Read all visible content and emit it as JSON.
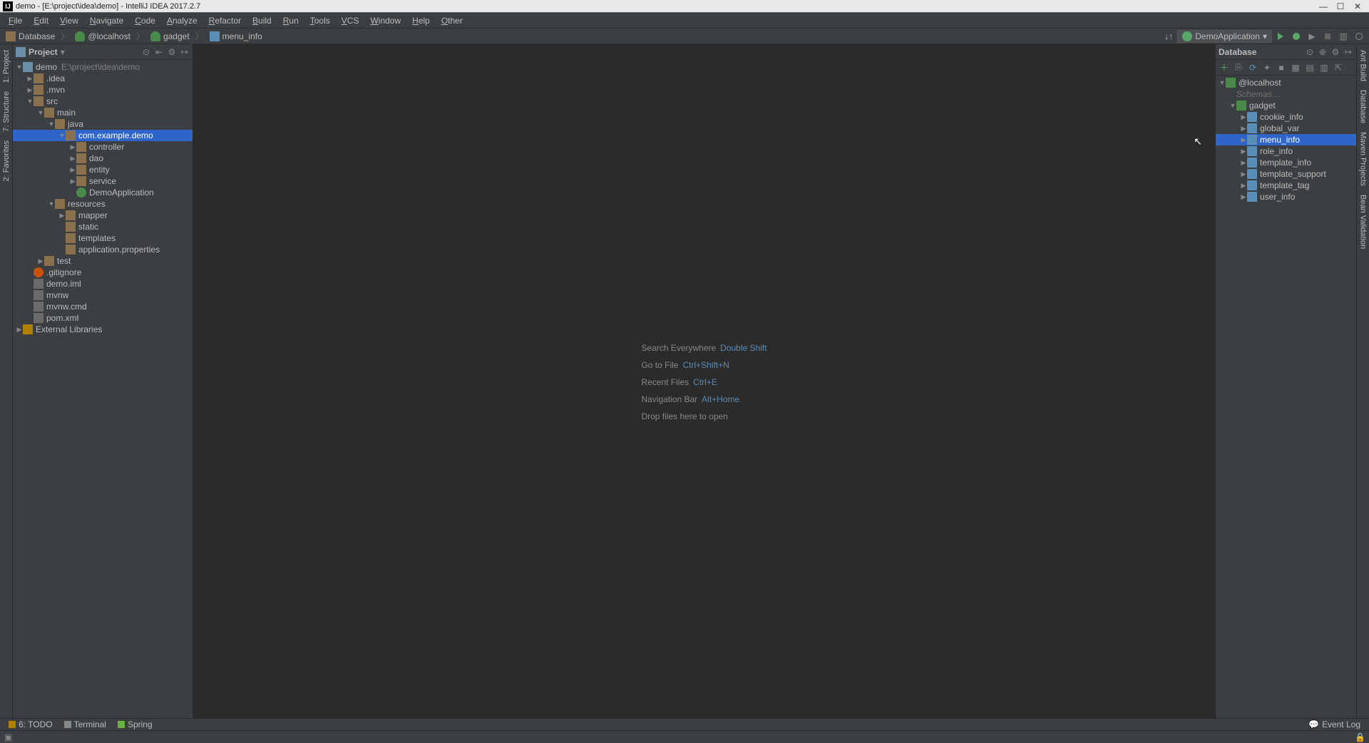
{
  "titlebar": {
    "title": "demo - [E:\\project\\idea\\demo] - IntelliJ IDEA 2017.2.7"
  },
  "menu": {
    "items": [
      "File",
      "Edit",
      "View",
      "Navigate",
      "Code",
      "Analyze",
      "Refactor",
      "Build",
      "Run",
      "Tools",
      "VCS",
      "Window",
      "Help",
      "Other"
    ]
  },
  "breadcrumbs": [
    {
      "icon": "folder",
      "label": "Database"
    },
    {
      "icon": "db",
      "label": "@localhost"
    },
    {
      "icon": "db",
      "label": "gadget"
    },
    {
      "icon": "table",
      "label": "menu_info"
    }
  ],
  "run": {
    "config": "DemoApplication"
  },
  "left_gutter": {
    "tabs": [
      "1: Project",
      "7: Structure",
      "2: Favorites"
    ]
  },
  "right_gutter": {
    "tabs": [
      "Ant Build",
      "Database",
      "Maven Projects",
      "Bean Validation"
    ]
  },
  "project_panel": {
    "title": "Project"
  },
  "project_tree": [
    {
      "d": 0,
      "exp": "open",
      "icon": "mod",
      "label": "demo",
      "extra": "E:\\project\\idea\\demo"
    },
    {
      "d": 1,
      "exp": "closed",
      "icon": "folder",
      "label": ".idea"
    },
    {
      "d": 1,
      "exp": "closed",
      "icon": "folder",
      "label": ".mvn"
    },
    {
      "d": 1,
      "exp": "open",
      "icon": "folder",
      "label": "src"
    },
    {
      "d": 2,
      "exp": "open",
      "icon": "folder",
      "label": "main"
    },
    {
      "d": 3,
      "exp": "open",
      "icon": "folder",
      "label": "java"
    },
    {
      "d": 4,
      "exp": "open",
      "icon": "pkg",
      "label": "com.example.demo",
      "sel": true
    },
    {
      "d": 5,
      "exp": "closed",
      "icon": "pkg",
      "label": "controller"
    },
    {
      "d": 5,
      "exp": "closed",
      "icon": "pkg",
      "label": "dao"
    },
    {
      "d": 5,
      "exp": "closed",
      "icon": "pkg",
      "label": "entity"
    },
    {
      "d": 5,
      "exp": "closed",
      "icon": "pkg",
      "label": "service"
    },
    {
      "d": 5,
      "exp": "none",
      "icon": "cls",
      "label": "DemoApplication"
    },
    {
      "d": 3,
      "exp": "open",
      "icon": "folder",
      "label": "resources"
    },
    {
      "d": 4,
      "exp": "closed",
      "icon": "folder",
      "label": "mapper"
    },
    {
      "d": 4,
      "exp": "none",
      "icon": "folder",
      "label": "static"
    },
    {
      "d": 4,
      "exp": "none",
      "icon": "folder",
      "label": "templates"
    },
    {
      "d": 4,
      "exp": "none",
      "icon": "prop",
      "label": "application.properties"
    },
    {
      "d": 2,
      "exp": "closed",
      "icon": "folder",
      "label": "test"
    },
    {
      "d": 1,
      "exp": "none",
      "icon": "git",
      "label": ".gitignore"
    },
    {
      "d": 1,
      "exp": "none",
      "icon": "file",
      "label": "demo.iml"
    },
    {
      "d": 1,
      "exp": "none",
      "icon": "file",
      "label": "mvnw"
    },
    {
      "d": 1,
      "exp": "none",
      "icon": "file",
      "label": "mvnw.cmd"
    },
    {
      "d": 1,
      "exp": "none",
      "icon": "file",
      "label": "pom.xml"
    },
    {
      "d": 0,
      "exp": "closed",
      "icon": "lib",
      "label": "External Libraries"
    }
  ],
  "empty_editor": {
    "rows": [
      {
        "label": "Search Everywhere",
        "hint": "Double Shift"
      },
      {
        "label": "Go to File",
        "hint": "Ctrl+Shift+N"
      },
      {
        "label": "Recent Files",
        "hint": "Ctrl+E"
      },
      {
        "label": "Navigation Bar",
        "hint": "Alt+Home"
      },
      {
        "label": "Drop files here to open",
        "hint": ""
      }
    ]
  },
  "db_panel": {
    "title": "Database",
    "schemas_label": "Schemas…"
  },
  "db_tree": {
    "root": {
      "label": "@localhost"
    },
    "schema": {
      "label": "gadget"
    },
    "tables": [
      "cookie_info",
      "global_var",
      "menu_info",
      "role_info",
      "template_info",
      "template_support",
      "template_tag",
      "user_info"
    ],
    "selected": "menu_info"
  },
  "bottom_dock": {
    "items": [
      {
        "icon": "todo",
        "label": "6: TODO"
      },
      {
        "icon": "term",
        "label": "Terminal"
      },
      {
        "icon": "spring",
        "label": "Spring"
      }
    ],
    "event_log": "Event Log"
  }
}
